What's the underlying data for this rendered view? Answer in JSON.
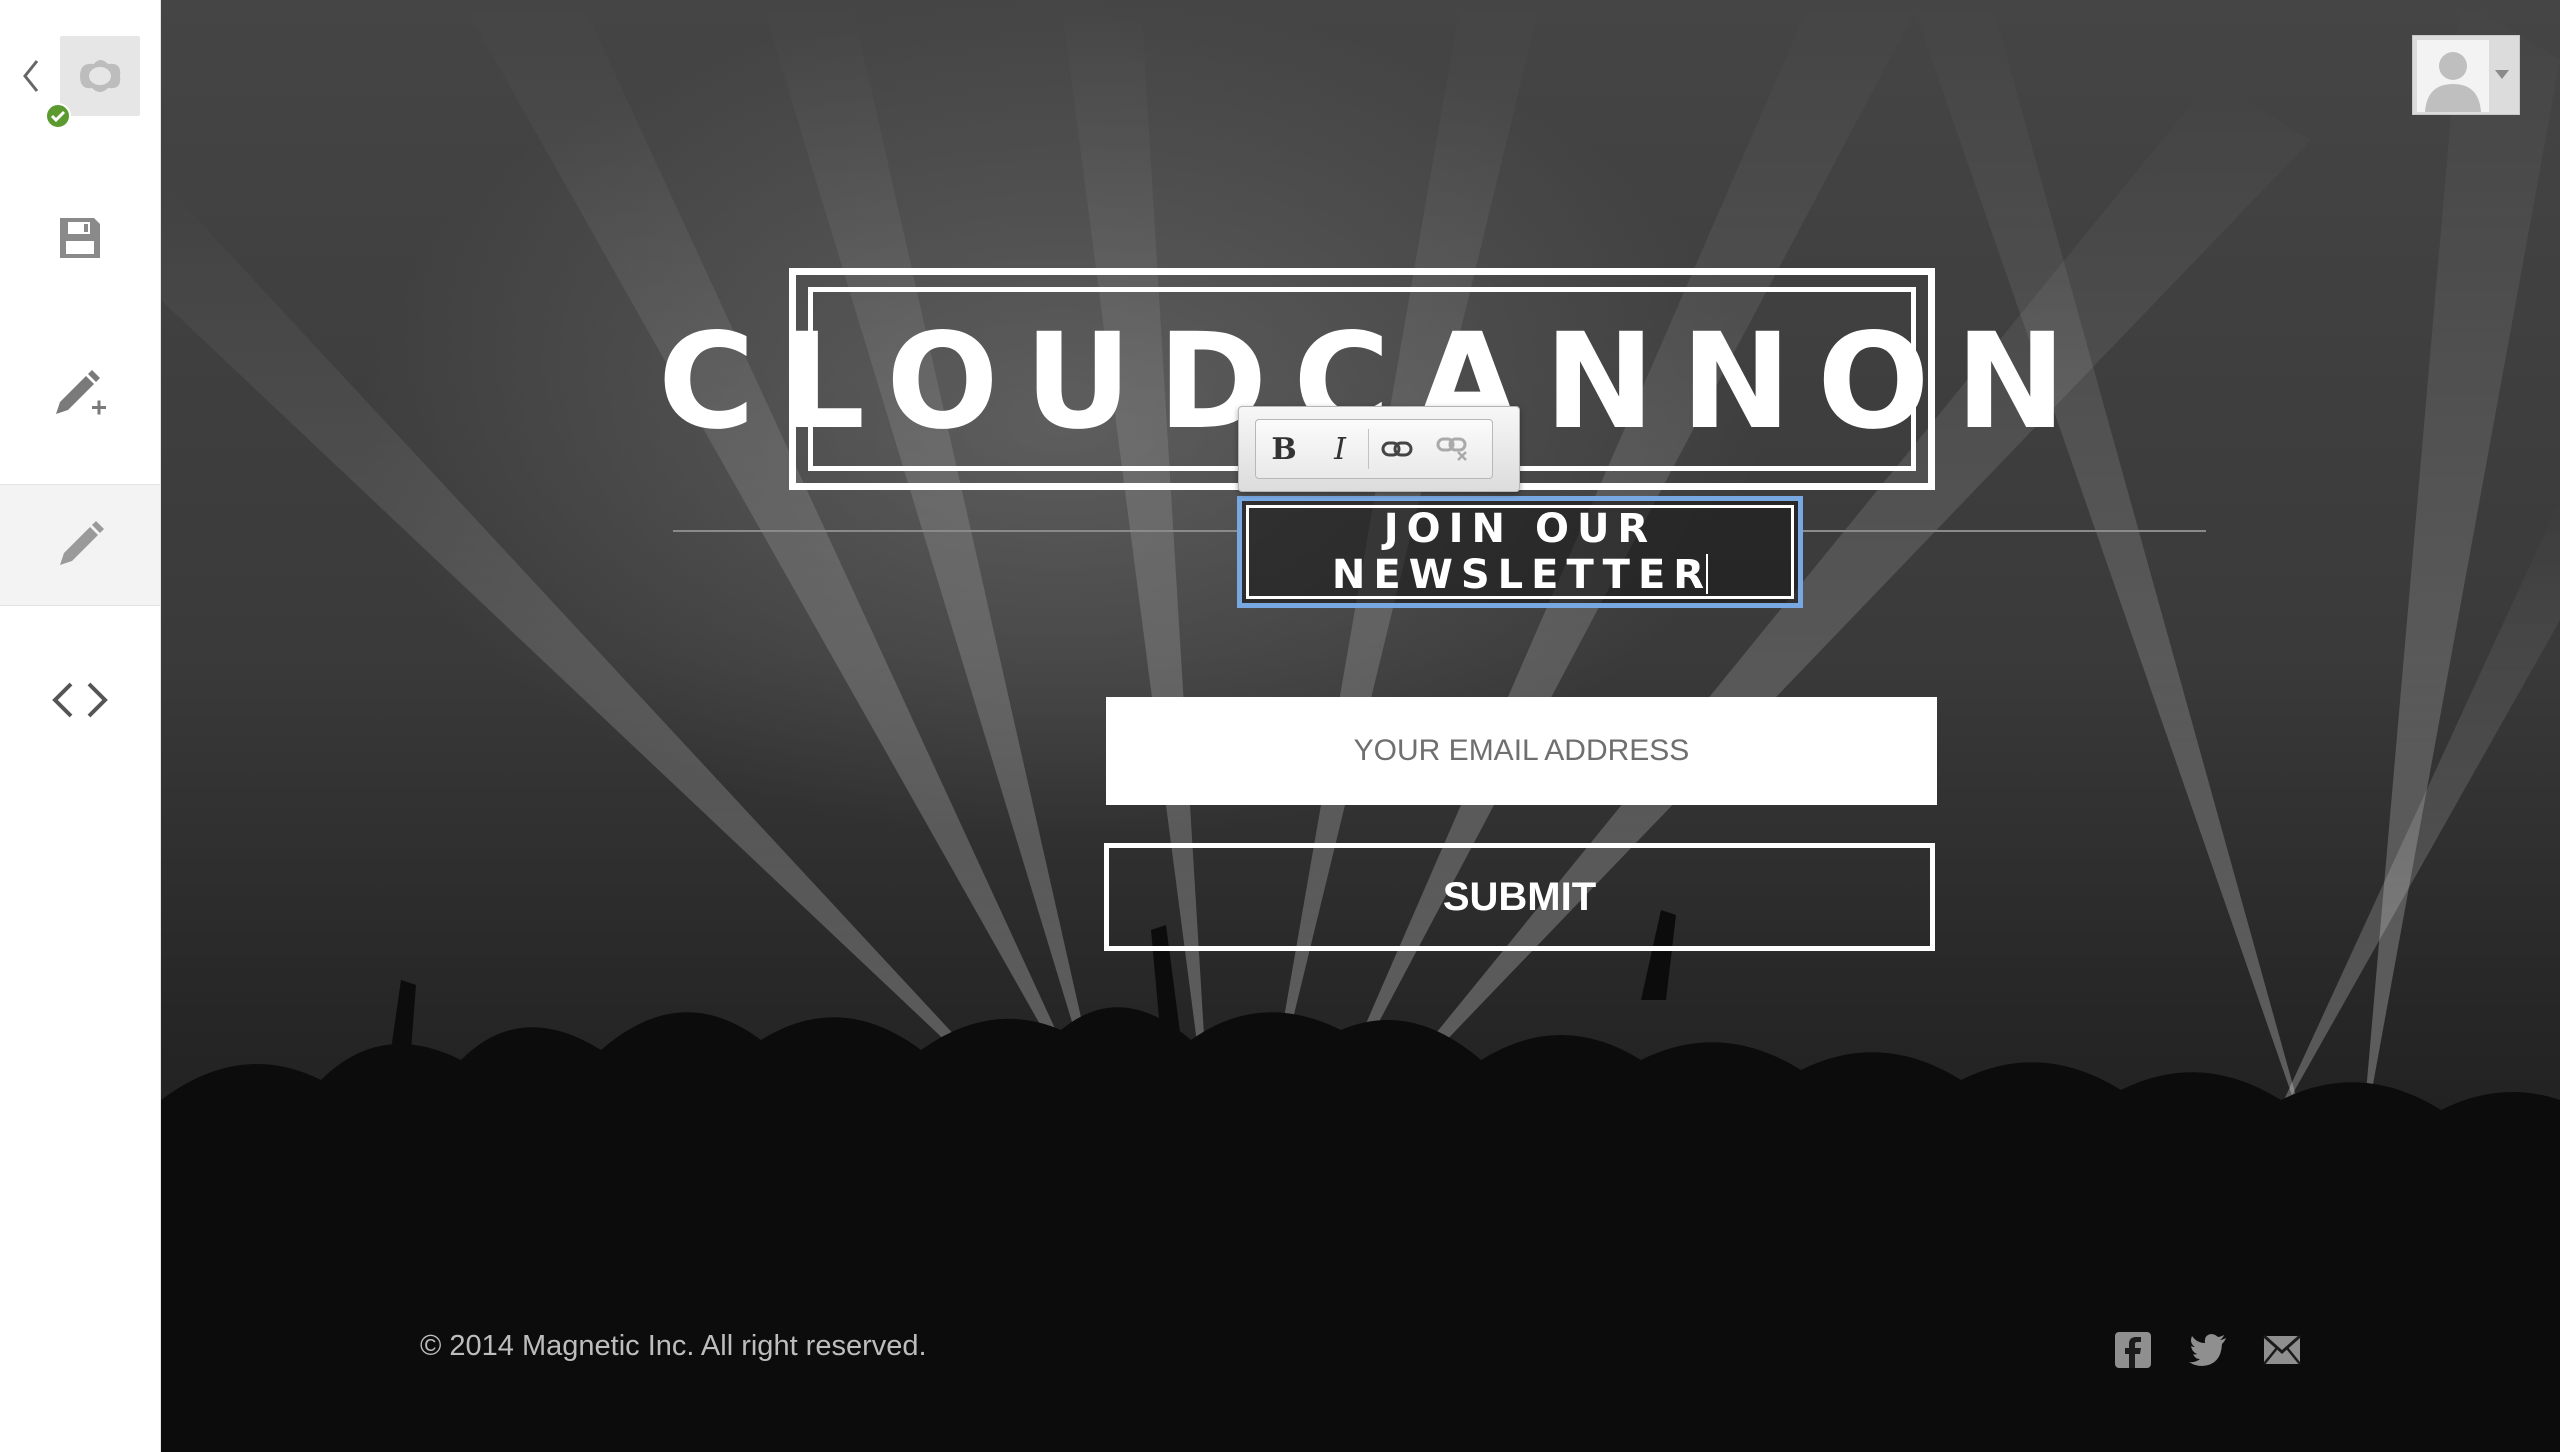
{
  "sidebar": {
    "back_icon": "chevron-left-icon",
    "logo_icon": "cloudcannon-logo-icon",
    "status_icon": "check-circle-icon",
    "status_color": "#5a9a2e",
    "items": [
      {
        "name": "save",
        "icon": "save-disk-icon"
      },
      {
        "name": "add-page",
        "icon": "pencil-plus-icon"
      },
      {
        "name": "visual-edit",
        "icon": "pencil-icon",
        "active": true
      },
      {
        "name": "source",
        "icon": "code-brackets-icon"
      }
    ]
  },
  "header": {
    "avatar_icon": "user-avatar-icon",
    "caret_icon": "caret-down-icon"
  },
  "hero": {
    "title": "CLOUDCANNON",
    "heading_line1": "JOIN OUR",
    "heading_line2": "NEWSLETTER"
  },
  "toolbar": {
    "bold_label": "B",
    "italic_label": "I",
    "link_icon": "link-icon",
    "unlink_icon": "unlink-icon"
  },
  "form": {
    "email_placeholder": "YOUR EMAIL ADDRESS",
    "email_value": "",
    "submit_label": "SUBMIT"
  },
  "footer": {
    "copyright": "© 2014 Magnetic Inc. All right reserved.",
    "social_icons": [
      "facebook-icon",
      "twitter-icon",
      "mail-icon"
    ]
  },
  "colors": {
    "selection_border": "#78a8e2",
    "sidebar_bg": "#ffffff",
    "stage_bg": "#3a3a3a"
  }
}
